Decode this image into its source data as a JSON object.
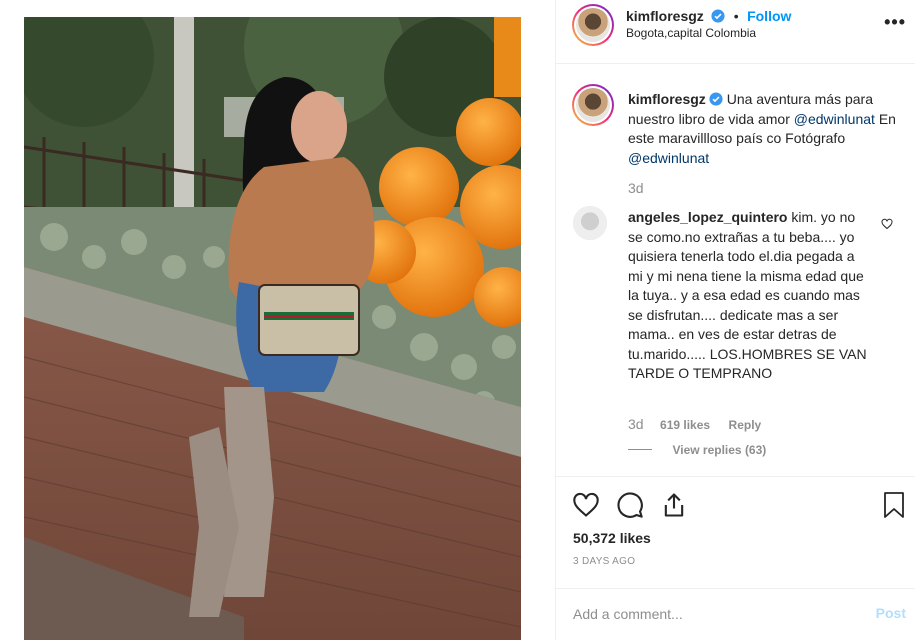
{
  "post": {
    "username": "kimfloresgz",
    "follow_label": "Follow",
    "separator": "•",
    "location": "Bogota,capital Colombia",
    "more_label": "•••"
  },
  "caption": {
    "username": "kimfloresgz",
    "text_1": "Una aventura más para nuestro libro de vida amor",
    "mention_1": "@edwinlunat",
    "text_2": "En este maravillloso país co Fotógrafo",
    "mention_2": "@edwinlunat",
    "time": "3d"
  },
  "comment": {
    "username": "angeles_lopez_quintero",
    "text": "kim. yo no se como.no extrañas a tu beba.... yo quisiera tenerla todo el.dia pegada a mi y mi nena tiene la misma edad que la tuya.. y a esa edad es cuando mas se disfrutan.... dedicate mas a ser mama.. en ves de estar detras de tu.marido..... LOS.HOMBRES SE VAN TARDE O TEMPRANO",
    "time": "3d",
    "likes": "619 likes",
    "reply_label": "Reply",
    "view_replies": "View replies (63)"
  },
  "actions": {
    "likes_count": "50,372 likes",
    "date": "3 DAYS AGO"
  },
  "comment_box": {
    "placeholder": "Add a comment...",
    "post_label": "Post"
  },
  "icons": [
    "verified-badge-icon",
    "more-options-icon",
    "heart-icon",
    "comment-icon",
    "share-icon",
    "bookmark-icon",
    "small-heart-icon"
  ],
  "colors": {
    "accent": "#0095f6",
    "mention": "#00376b",
    "muted": "#8e8e8e",
    "post_disabled": "#b2dffc"
  }
}
